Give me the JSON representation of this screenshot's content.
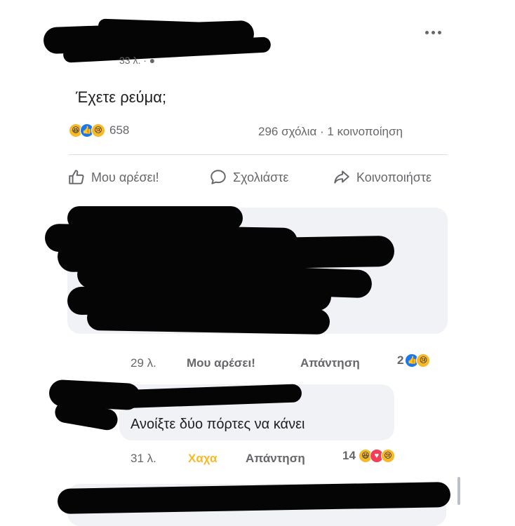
{
  "post": {
    "time": "33 λ. · ",
    "text": "Έχετε ρεύμα;",
    "reaction_count": "658",
    "stats": "296 σχόλια · 1 κοινοποίηση",
    "reactions": [
      "haha-icon",
      "like-icon",
      "sad-icon"
    ]
  },
  "actions": {
    "like": "Μου αρέσει!",
    "comment": "Σχολιάστε",
    "share": "Κοινοποιήστε"
  },
  "comments": [
    {
      "time": "29 λ.",
      "like_label": "Μου αρέσει!",
      "reply_label": "Απάντηση",
      "reaction_count": "2",
      "reactions": [
        "like-icon",
        "sad-icon"
      ]
    },
    {
      "text": "Ανοίξτε δύο πόρτες να κάνει",
      "time": "31 λ.",
      "like_label": "Χαχα",
      "reply_label": "Απάντηση",
      "reaction_count": "14",
      "reactions": [
        "haha-icon",
        "love-icon",
        "sad-icon"
      ]
    }
  ],
  "colors": {
    "haha": "#f7b928",
    "like": "#1877f2",
    "love": "#f33e58",
    "muted": "#65676b",
    "bubble": "#f0f2f5"
  }
}
